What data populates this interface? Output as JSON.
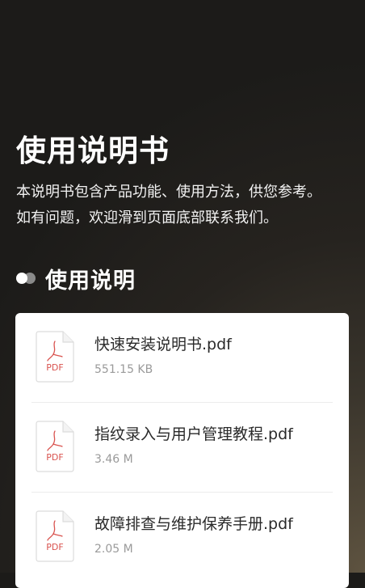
{
  "hero": {
    "title": "使用说明书",
    "description_lines": [
      "本说明书包含产品功能、使用方法，供您参考。",
      "如有问题，欢迎滑到页面底部联系我们。"
    ]
  },
  "section": {
    "title": "使用说明"
  },
  "files": [
    {
      "name": "快速安装说明书.pdf",
      "size": "551.15 KB",
      "icon": "pdf-file-icon",
      "badge": "PDF"
    },
    {
      "name": "指纹录入与用户管理教程.pdf",
      "size": "3.46 M",
      "icon": "pdf-file-icon",
      "badge": "PDF"
    },
    {
      "name": "故障排查与维护保养手册.pdf",
      "size": "2.05 M",
      "icon": "pdf-file-icon",
      "badge": "PDF"
    }
  ],
  "colors": {
    "pdf_red": "#d9534f",
    "accent_white": "#ffffff",
    "dot_gray": "#8a8a8a"
  }
}
